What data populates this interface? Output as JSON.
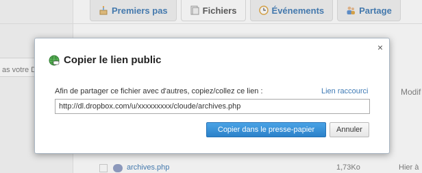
{
  "colors": {
    "link": "#3d79b4",
    "primary_button": "#2b81c9"
  },
  "background": {
    "search_placeholder": "as votre D",
    "tabs": [
      {
        "label": "Premiers pas",
        "icon": "cake-icon",
        "active": false
      },
      {
        "label": "Fichiers",
        "icon": "files-icon",
        "active": true
      },
      {
        "label": "Événements",
        "icon": "clock-icon",
        "active": false
      },
      {
        "label": "Partage",
        "icon": "people-icon",
        "active": false
      }
    ],
    "column_modified": "Modif",
    "file": {
      "name": "archives.php",
      "size": "1,73Ko",
      "date": "Hier à"
    }
  },
  "dialog": {
    "title": "Copier le lien public",
    "icon": "globe-link-icon",
    "instruction": "Afin de partager ce fichier avec d'autres, copiez/collez ce lien :",
    "short_link": "Lien raccourci",
    "url": "http://dl.dropbox.com/u/xxxxxxxxx/cloude/archives.php",
    "copy_button": "Copier dans le presse-papier",
    "cancel_button": "Annuler",
    "close_symbol": "×"
  }
}
